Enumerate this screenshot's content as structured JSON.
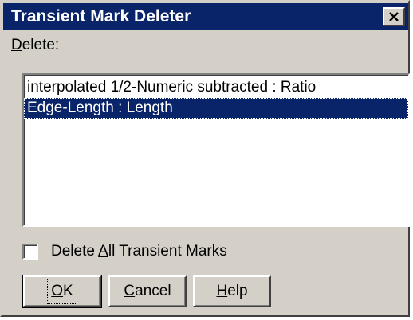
{
  "window": {
    "title": "Transient Mark Deleter",
    "close_icon": "close-icon"
  },
  "delete_label": {
    "mnemonic": "D",
    "rest": "elete:"
  },
  "list": {
    "items": [
      {
        "label": "interpolated 1/2-Numeric subtracted : Ratio",
        "selected": false
      },
      {
        "label": "Edge-Length : Length",
        "selected": true
      }
    ]
  },
  "checkbox": {
    "label_before": "Delete ",
    "mnemonic": "A",
    "label_after": "ll Transient Marks",
    "checked": false
  },
  "buttons": {
    "ok": {
      "mnemonic": "O",
      "rest": "K"
    },
    "cancel": {
      "mnemonic": "C",
      "rest": "ancel"
    },
    "help": {
      "mnemonic": "H",
      "rest": "elp"
    }
  },
  "colors": {
    "title_bar": "#0a246a",
    "selection": "#0a246a",
    "dialog_face": "#d4d0c8"
  }
}
